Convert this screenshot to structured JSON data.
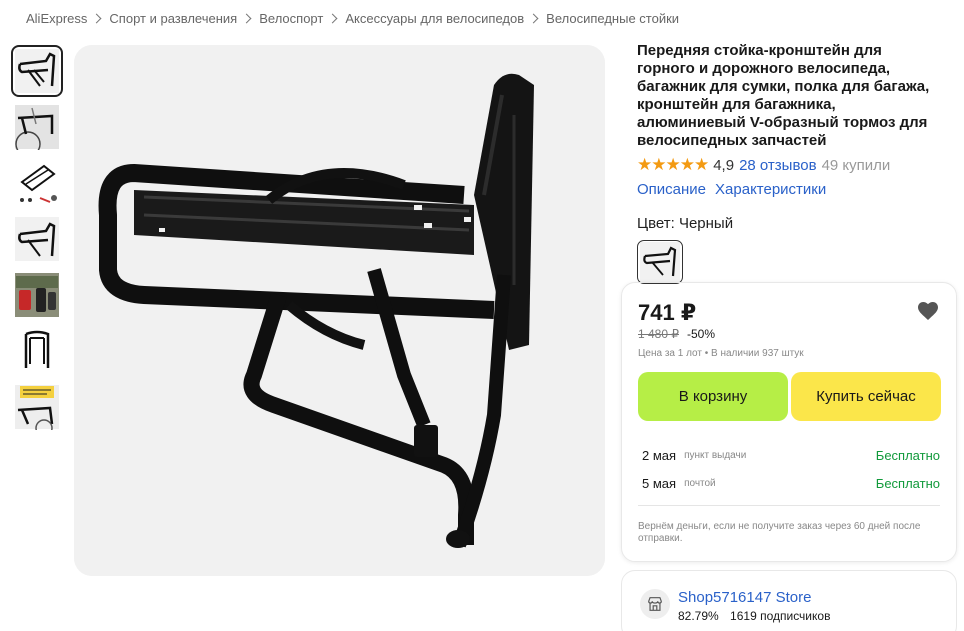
{
  "breadcrumb": [
    "AliExpress",
    "Спорт и развлечения",
    "Велоспорт",
    "Аксессуары для велосипедов",
    "Велосипедные стойки"
  ],
  "product": {
    "title": "Передняя стойка-кронштейн для горного и дорожного велосипеда, багажник для сумки, полка для багажа, кронштейн для багажника, алюминиевый V-образный тормоз для велосипедных запчастей",
    "stars": "★★★★★",
    "rating": "4,9",
    "reviews": "28 отзывов",
    "sold": "49 купили",
    "tabs": [
      "Описание",
      "Характеристики"
    ],
    "color_label": "Цвет: Черный"
  },
  "thumbnails": [
    {
      "icon": "rack-black-icon"
    },
    {
      "icon": "rack-on-bike-icon"
    },
    {
      "icon": "rack-parts-icon"
    },
    {
      "icon": "rack-black-icon"
    },
    {
      "icon": "rack-with-bags-icon"
    },
    {
      "icon": "rack-front-view-icon"
    },
    {
      "icon": "rack-promo-icon"
    }
  ],
  "purchase": {
    "price": "741 ₽",
    "old_price": "1 480 ₽",
    "discount": "-50%",
    "stock": "Цена за 1 лот • В наличии 937 штук",
    "cart_button": "В корзину",
    "buy_button": "Купить сейчас",
    "deliveries": [
      {
        "date": "2 мая",
        "method": "пункт выдачи",
        "cost": "Бесплатно"
      },
      {
        "date": "5 мая",
        "method": "почтой",
        "cost": "Бесплатно"
      }
    ],
    "guarantee": "Вернём деньги, если не получите заказ через 60 дней после отправки."
  },
  "store": {
    "name": "Shop5716147 Store",
    "rating": "82.79%",
    "subscribers": "1619 подписчиков"
  },
  "colors": {
    "link": "#2a61c9",
    "cart_button": "#b6ee46",
    "buy_button": "#fbe64a",
    "free_delivery": "#119a3b",
    "stars": "#f39a12"
  }
}
